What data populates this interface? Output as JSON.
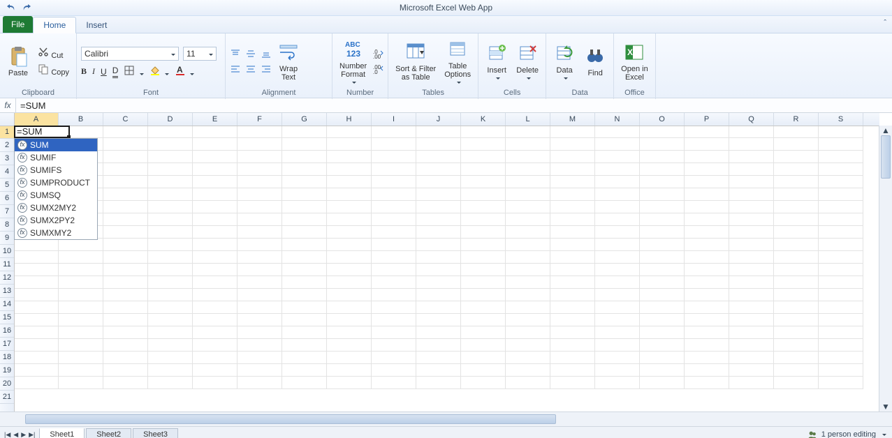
{
  "app_title": "Microsoft Excel Web App",
  "tabs": {
    "file": "File",
    "home": "Home",
    "insert": "Insert"
  },
  "ribbon": {
    "clipboard": {
      "label": "Clipboard",
      "paste": "Paste",
      "cut": "Cut",
      "copy": "Copy"
    },
    "font": {
      "label": "Font",
      "family": "Calibri",
      "size": "11",
      "bold": "B",
      "italic": "I",
      "underline": "U",
      "dbl_underline": "D"
    },
    "alignment": {
      "label": "Alignment",
      "wrap": "Wrap\nText"
    },
    "number": {
      "label": "Number",
      "format": "Number\nFormat"
    },
    "tables": {
      "label": "Tables",
      "sort_filter": "Sort & Filter\nas Table",
      "options": "Table\nOptions"
    },
    "cells": {
      "label": "Cells",
      "insert": "Insert",
      "delete": "Delete"
    },
    "data": {
      "label": "Data",
      "data": "Data",
      "find": "Find"
    },
    "office": {
      "label": "Office",
      "open": "Open in\nExcel"
    }
  },
  "formula_bar": {
    "fx": "fx",
    "value": "=SUM"
  },
  "grid": {
    "columns": [
      "A",
      "B",
      "C",
      "D",
      "E",
      "F",
      "G",
      "H",
      "I",
      "J",
      "K",
      "L",
      "M",
      "N",
      "O",
      "P",
      "Q",
      "R",
      "S"
    ],
    "rows": [
      "1",
      "2",
      "3",
      "4",
      "5",
      "6",
      "7",
      "8",
      "9",
      "10",
      "11",
      "12",
      "13",
      "14",
      "15",
      "16",
      "17",
      "18",
      "19",
      "20",
      "21"
    ],
    "active_cell_value": "=SUM"
  },
  "autocomplete": {
    "items": [
      "SUM",
      "SUMIF",
      "SUMIFS",
      "SUMPRODUCT",
      "SUMSQ",
      "SUMX2MY2",
      "SUMX2PY2",
      "SUMXMY2"
    ],
    "highlighted_index": 0
  },
  "sheets": {
    "tabs": [
      "Sheet1",
      "Sheet2",
      "Sheet3"
    ],
    "active_index": 0
  },
  "status": {
    "editing": "1 person editing"
  }
}
